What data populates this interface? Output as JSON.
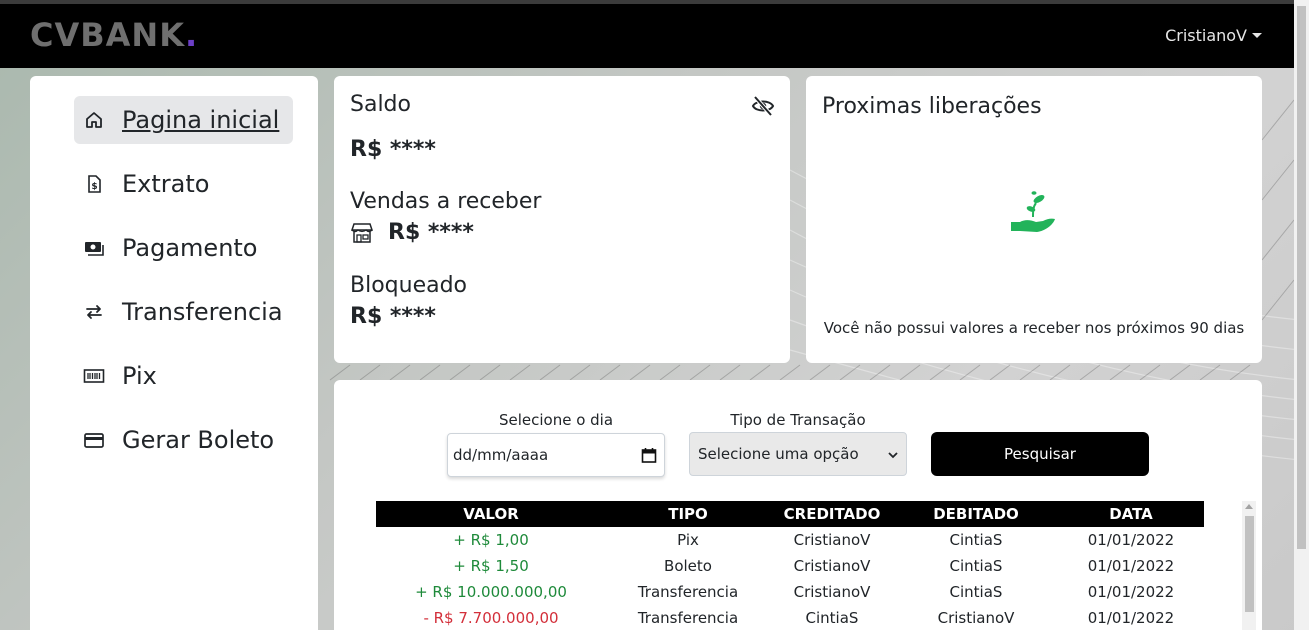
{
  "navbar": {
    "brand": "CVBANK",
    "brand_dot": ".",
    "user": "CristianoV"
  },
  "sidebar": {
    "items": [
      {
        "label": "Pagina inicial",
        "icon": "home-icon",
        "active": true
      },
      {
        "label": "Extrato",
        "icon": "receipt-icon",
        "active": false
      },
      {
        "label": "Pagamento",
        "icon": "cash-icon",
        "active": false
      },
      {
        "label": "Transferencia",
        "icon": "transfer-arrows-icon",
        "active": false
      },
      {
        "label": "Pix",
        "icon": "barcode-icon",
        "active": false
      },
      {
        "label": "Gerar Boleto",
        "icon": "credit-card-icon",
        "active": false
      }
    ]
  },
  "balance": {
    "saldo_label": "Saldo",
    "saldo_value": "R$ ****",
    "vendas_label": "Vendas a receber",
    "vendas_value": "R$ ****",
    "bloqueado_label": "Bloqueado",
    "bloqueado_value": "R$ ****"
  },
  "liberacoes": {
    "title": "Proximas liberações",
    "message": "Você não possui valores a receber nos próximos 90 dias"
  },
  "filters": {
    "date_label": "Selecione o dia",
    "date_placeholder": "dd/mm/aaaa",
    "type_label": "Tipo de Transação",
    "type_selected": "Selecione uma opção",
    "search_button": "Pesquisar"
  },
  "table": {
    "headers": [
      "VALOR",
      "TIPO",
      "CREDITADO",
      "DEBITADO",
      "DATA"
    ],
    "rows": [
      {
        "valor": "+ R$ 1,00",
        "tipo": "Pix",
        "creditado": "CristianoV",
        "debitado": "CintiaS",
        "data": "01/01/2022"
      },
      {
        "valor": "+ R$ 1,50",
        "tipo": "Boleto",
        "creditado": "CristianoV",
        "debitado": "CintiaS",
        "data": "01/01/2022"
      },
      {
        "valor": "+ R$ 10.000.000,00",
        "tipo": "Transferencia",
        "creditado": "CristianoV",
        "debitado": "CintiaS",
        "data": "01/01/2022"
      },
      {
        "valor": "- R$ 7.700.000,00",
        "tipo": "Transferencia",
        "creditado": "CintiaS",
        "debitado": "CristianoV",
        "data": "01/01/2022"
      }
    ]
  },
  "colors": {
    "positive": "#1e8a3a",
    "negative": "#d32f3a",
    "brand_dot": "#6c3fc6",
    "plant_icon": "#22b35a"
  }
}
